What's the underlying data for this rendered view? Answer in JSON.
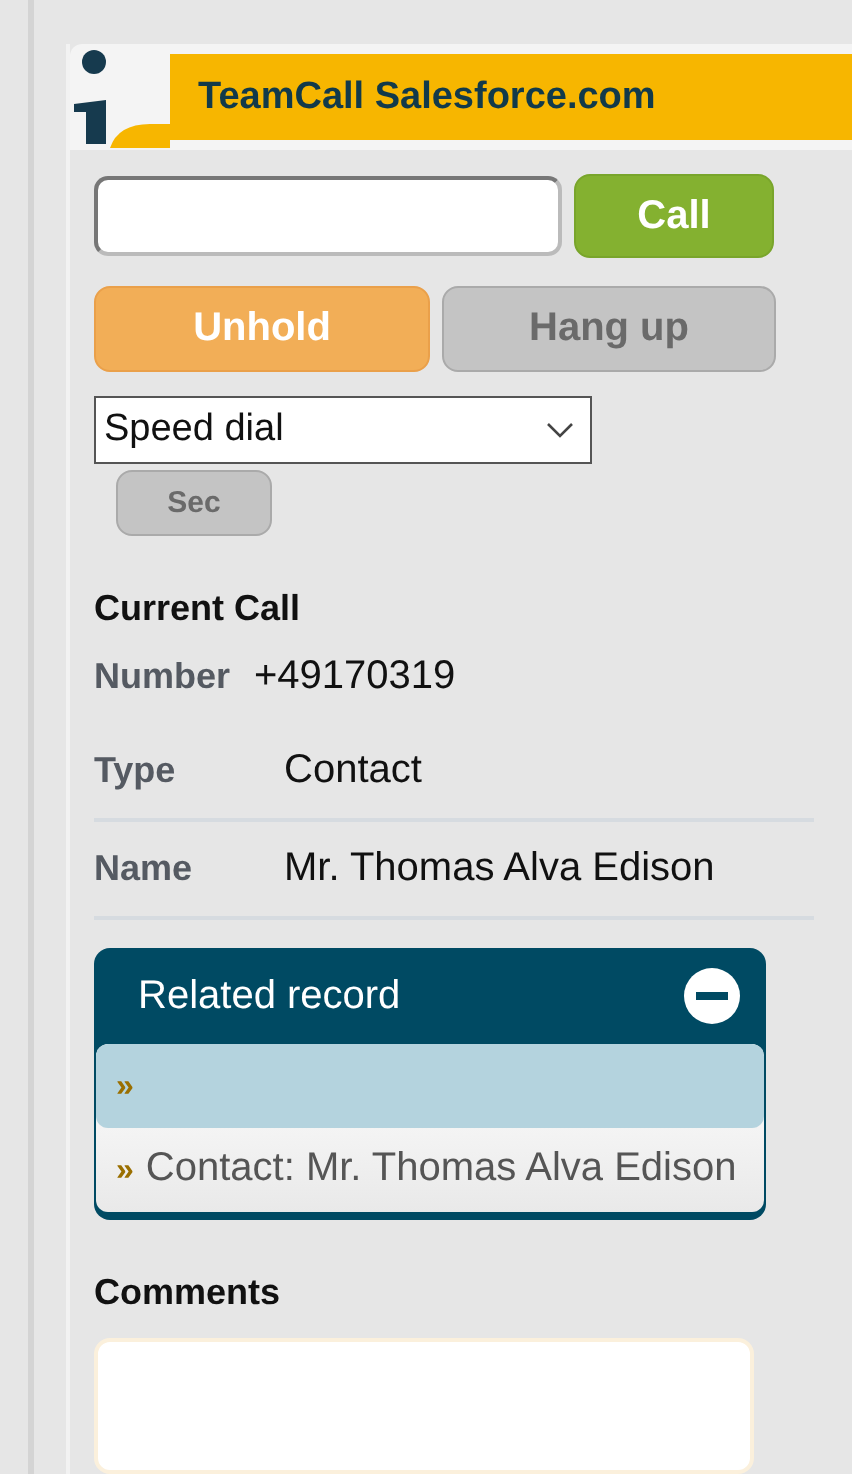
{
  "header": {
    "title": "TeamCall Salesforce.com"
  },
  "dial": {
    "call_button": "Call"
  },
  "actions": [
    {
      "label": "Unhold",
      "kind": "hold",
      "disabled": false
    },
    {
      "label": "Hang up",
      "kind": "hangup",
      "disabled": true
    }
  ],
  "speed_dial": {
    "value": "Speed dial",
    "button": "Sec",
    "button_disabled": true
  },
  "current_call": {
    "title": "Current Call",
    "fields": [
      {
        "label": "Number",
        "value": "+49170319"
      },
      {
        "label": "Type",
        "value": "Contact"
      },
      {
        "label": "Name",
        "value": "Mr. Thomas Alva Edison"
      }
    ]
  },
  "related_record": {
    "title": "Related record",
    "expanded": true,
    "items": [
      {
        "marker": "»",
        "selected": true
      },
      {
        "marker": "»",
        "label": "Contact: Mr. Thomas Alva Edison",
        "selected": false
      }
    ]
  },
  "comments": {
    "title": "Comments"
  }
}
